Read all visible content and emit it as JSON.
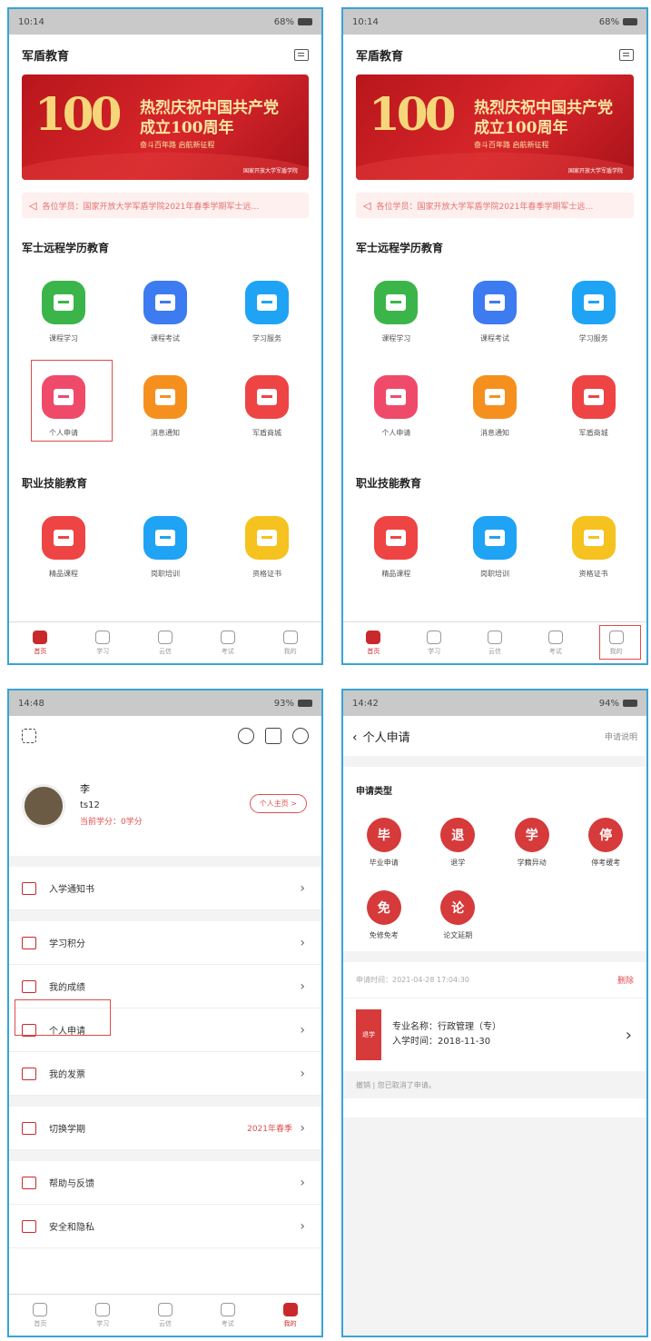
{
  "panel1": {
    "status": {
      "time": "10:14",
      "battery": "68%"
    },
    "title": "军盾教育",
    "banner": {
      "big": "100",
      "line1": "热烈庆祝中国共产党",
      "line2": "成立100周年",
      "line3": "奋斗百年路  启航新征程",
      "line4": "国家开放大学军盾学院"
    },
    "notice": "各位学员：国家开放大学军盾学院2021年春季学期军士远…",
    "section1": "军士远程学历教育",
    "section2": "职业技能教育",
    "grid1": [
      {
        "label": "课程学习",
        "color": "#3bb54a"
      },
      {
        "label": "课程考试",
        "color": "#3d7bf0"
      },
      {
        "label": "学习服务",
        "color": "#1fa3f5"
      },
      {
        "label": "个人申请",
        "color": "#f04a6a"
      },
      {
        "label": "消息通知",
        "color": "#f5901f"
      },
      {
        "label": "军盾商城",
        "color": "#ee4444"
      }
    ],
    "grid2": [
      {
        "label": "精品课程",
        "color": "#ee4444"
      },
      {
        "label": "岗职培训",
        "color": "#1fa3f5"
      },
      {
        "label": "资格证书",
        "color": "#f5c21f"
      }
    ],
    "tabs": [
      "首页",
      "学习",
      "云信",
      "考试",
      "我的"
    ]
  },
  "panel2": {
    "status": {
      "time": "10:14",
      "battery": "68%"
    }
  },
  "panel3": {
    "status": {
      "time": "14:48",
      "battery": "93%"
    },
    "profile": {
      "name": "李",
      "id": "ts12",
      "credit": "当前学分：0学分",
      "home_btn": "个人主页 >"
    },
    "menu": [
      {
        "label": "入学通知书"
      },
      {
        "label": "学习积分"
      },
      {
        "label": "我的成绩"
      },
      {
        "label": "个人申请"
      },
      {
        "label": "我的发票"
      },
      {
        "label": "切换学期",
        "extra": "2021年春季"
      },
      {
        "label": "帮助与反馈"
      },
      {
        "label": "安全和隐私"
      }
    ],
    "tabs": [
      "首页",
      "学习",
      "云信",
      "考试",
      "我的"
    ]
  },
  "panel4": {
    "status": {
      "time": "14:42",
      "battery": "94%"
    },
    "title": "个人申请",
    "explain": "申请说明",
    "type_label": "申请类型",
    "types": [
      {
        "glyph": "毕",
        "label": "毕业申请"
      },
      {
        "glyph": "退",
        "label": "退学"
      },
      {
        "glyph": "学",
        "label": "学籍异动"
      },
      {
        "glyph": "停",
        "label": "停考缓考"
      },
      {
        "glyph": "免",
        "label": "免修免考"
      },
      {
        "glyph": "论",
        "label": "论文延期"
      }
    ],
    "record": {
      "time": "申请时间：2021-04-28 17:04:30",
      "delete": "删除",
      "tag": "退学",
      "major": "专业名称：行政管理（专）",
      "enroll": "入学时间：2018-11-30",
      "status": "撤销 | 您已取消了申请。"
    }
  }
}
